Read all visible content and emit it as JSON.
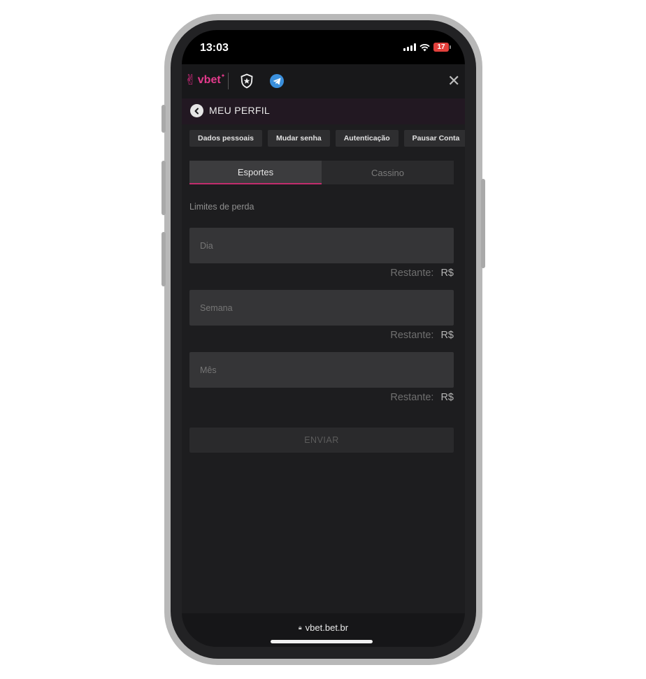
{
  "status_bar": {
    "time": "13:03",
    "battery": "17"
  },
  "header": {
    "brand_name": "vbet",
    "brand_color": "#e33a8c",
    "shield_icon": "shield-star-icon",
    "telegram_icon": "telegram-icon",
    "close_label": "✕"
  },
  "profile": {
    "title": "MEU PERFIL"
  },
  "tabs": [
    {
      "label": "Dados pessoais"
    },
    {
      "label": "Mudar senha"
    },
    {
      "label": "Autenticação"
    },
    {
      "label": "Pausar Conta"
    }
  ],
  "segments": {
    "sports": "Esportes",
    "casino": "Cassino",
    "active": "Esportes",
    "accent_color": "#c22c6d"
  },
  "section_label": "Limites de perda",
  "fields": [
    {
      "placeholder": "Dia",
      "remaining_label": "Restante:",
      "currency": "R$"
    },
    {
      "placeholder": "Semana",
      "remaining_label": "Restante:",
      "currency": "R$"
    },
    {
      "placeholder": "Mês",
      "remaining_label": "Restante:",
      "currency": "R$"
    }
  ],
  "submit_label": "ENVIAR",
  "url_bar": {
    "url": "vbet.bet.br"
  }
}
